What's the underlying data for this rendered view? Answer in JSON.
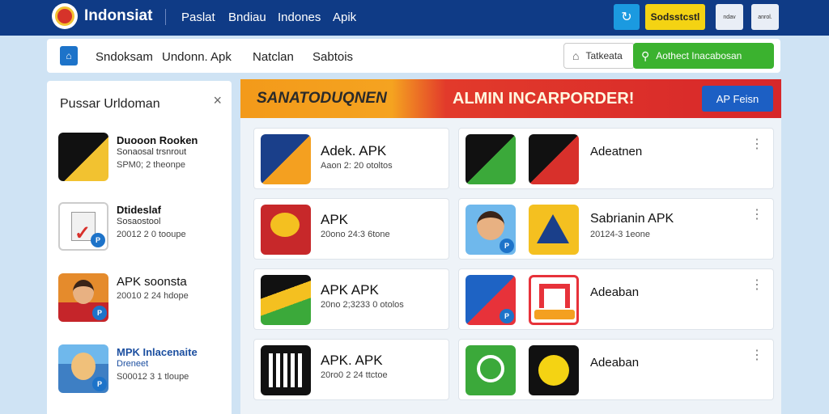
{
  "topbar": {
    "brand": "Indonsiat",
    "nav": [
      "Paslat",
      "Bndiau",
      "Indones",
      "Apik"
    ],
    "share_icon": "share-icon",
    "signin_label": "Sodsstcstl",
    "app1_label": "ndav",
    "app2_label": "anrol."
  },
  "subbar": {
    "nav": [
      "Sndoksam",
      "Undonn. Apk",
      "Natclan",
      "Sabtois"
    ],
    "install_label": "Tatkeata",
    "search_label": "Aothect Inacabosan"
  },
  "leftpanel": {
    "title": "Pussar Urldoman",
    "close": "×",
    "items": [
      {
        "name": "Duooon Rooken",
        "sub": "Sonaosal trsnrout",
        "meta": "SPM0; 2 theonpe",
        "colors": [
          "#111",
          "#f2c230"
        ]
      },
      {
        "name": "Dtideslaf",
        "sub": "Sosaostool",
        "meta": "20012 2 0 tooupe",
        "colors": [
          "#fff",
          "#d8302b"
        ]
      },
      {
        "name": "APK soonsta",
        "sub": "",
        "meta": "20010 2 24 hdope",
        "colors": [
          "#e58b2c",
          "#c5252a"
        ]
      },
      {
        "name": "MPK Inlacenaite",
        "sub": "Dreneet",
        "meta": "S00012 3 1 tloupe",
        "colors": [
          "#6fb8ec",
          "#3e7fc4"
        ],
        "accent": true
      }
    ]
  },
  "banner": {
    "left_text": "SANATODUQNEN",
    "right_text": "ALMIN INCARPORDER!",
    "button": "AP Feisn"
  },
  "cards_left": [
    {
      "title": "Adek. APK",
      "meta": "Aaon 2: 20 otoltos",
      "colors": [
        "#1a3f8a",
        "#f4a020"
      ]
    },
    {
      "title": "APK",
      "meta": "20ono 24:3 6tone",
      "colors": [
        "#c7282a",
        "#f4c020"
      ]
    },
    {
      "title": "APK APK",
      "meta": "20no 2;3233 0 otolos",
      "colors": [
        "#111",
        "#f4c020"
      ]
    },
    {
      "title": "APK. APK",
      "meta": "20ro0 2 24 ttctoe",
      "colors": [
        "#111",
        "#fff"
      ]
    }
  ],
  "cards_right": [
    {
      "title": "Adeatnen",
      "meta": "",
      "colors_a": [
        "#111",
        "#3ba93a"
      ],
      "colors_b": [
        "#111",
        "#d8302b"
      ]
    },
    {
      "title": "Sabrianin APK",
      "meta": "20124-3 1eone",
      "colors_a": [
        "#6fb8ec",
        "#f4c020"
      ],
      "colors_b": [
        "#f4c020",
        "#1a3f8a"
      ]
    },
    {
      "title": "Adeaban",
      "meta": "",
      "colors_a": [
        "#1e63c4",
        "#e7323a"
      ],
      "colors_b": [
        "#fff",
        "#e7323a"
      ]
    },
    {
      "title": "Adeaban",
      "meta": "",
      "colors_a": [
        "#3ba93a",
        "#2e8e2c"
      ],
      "colors_b": [
        "#111",
        "#f4d313"
      ]
    }
  ],
  "colors": {
    "topbar": "#0f3b86",
    "accent_green": "#3bb22f",
    "signin_yellow": "#f4d313",
    "banner_red": "#d7272a"
  }
}
